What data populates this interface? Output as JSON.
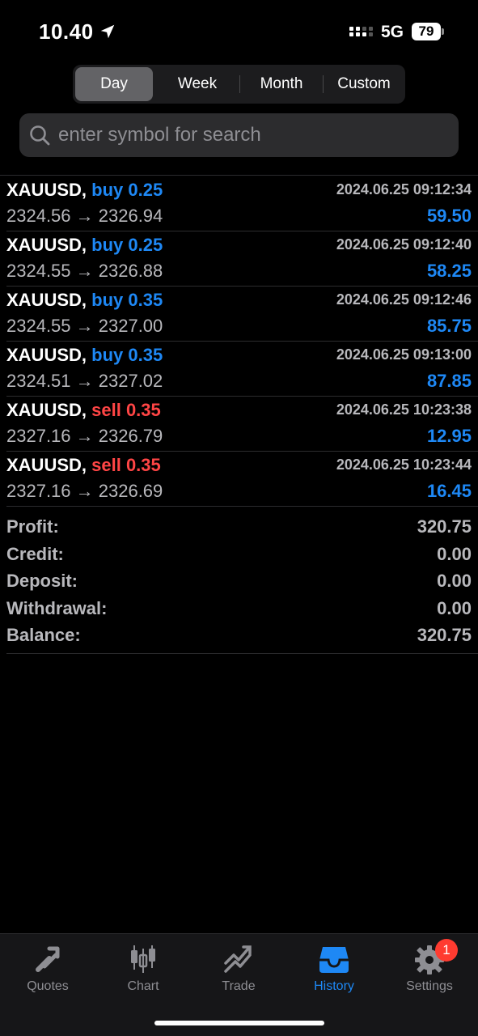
{
  "status_bar": {
    "time": "10.40",
    "network": "5G",
    "battery": "79"
  },
  "period_tabs": [
    {
      "label": "Day",
      "active": true
    },
    {
      "label": "Week",
      "active": false
    },
    {
      "label": "Month",
      "active": false
    },
    {
      "label": "Custom",
      "active": false
    }
  ],
  "search": {
    "placeholder": "enter symbol for search"
  },
  "deals": [
    {
      "symbol": "XAUUSD,",
      "direction": "buy 0.25",
      "type": "buy",
      "time": "2024.06.25 09:12:34",
      "prices": "2324.56 → 2326.94",
      "profit": "59.50"
    },
    {
      "symbol": "XAUUSD,",
      "direction": "buy 0.25",
      "type": "buy",
      "time": "2024.06.25 09:12:40",
      "prices": "2324.55 → 2326.88",
      "profit": "58.25"
    },
    {
      "symbol": "XAUUSD,",
      "direction": "buy 0.35",
      "type": "buy",
      "time": "2024.06.25 09:12:46",
      "prices": "2324.55 → 2327.00",
      "profit": "85.75"
    },
    {
      "symbol": "XAUUSD,",
      "direction": "buy 0.35",
      "type": "buy",
      "time": "2024.06.25 09:13:00",
      "prices": "2324.51 → 2327.02",
      "profit": "87.85"
    },
    {
      "symbol": "XAUUSD,",
      "direction": "sell 0.35",
      "type": "sell",
      "time": "2024.06.25 10:23:38",
      "prices": "2327.16 → 2326.79",
      "profit": "12.95"
    },
    {
      "symbol": "XAUUSD,",
      "direction": "sell 0.35",
      "type": "sell",
      "time": "2024.06.25 10:23:44",
      "prices": "2327.16 → 2326.69",
      "profit": "16.45"
    }
  ],
  "summary": [
    {
      "label": "Profit:",
      "value": "320.75"
    },
    {
      "label": "Credit:",
      "value": "0.00"
    },
    {
      "label": "Deposit:",
      "value": "0.00"
    },
    {
      "label": "Withdrawal:",
      "value": "0.00"
    },
    {
      "label": "Balance:",
      "value": "320.75"
    }
  ],
  "tab_bar": [
    {
      "label": "Quotes",
      "icon": "quotes-icon",
      "active": false
    },
    {
      "label": "Chart",
      "icon": "chart-icon",
      "active": false
    },
    {
      "label": "Trade",
      "icon": "trade-icon",
      "active": false
    },
    {
      "label": "History",
      "icon": "history-icon",
      "active": true
    },
    {
      "label": "Settings",
      "icon": "settings-icon",
      "active": false,
      "badge": "1"
    }
  ],
  "colors": {
    "background": "#000000",
    "buy": "#1e88f5",
    "sell": "#ff4545",
    "profit": "#1e88f5",
    "active_tab": "#1e88f5",
    "badge": "#ff3b30"
  }
}
